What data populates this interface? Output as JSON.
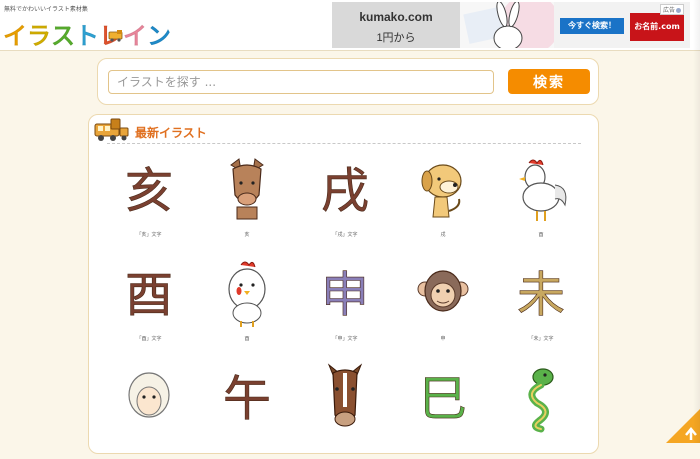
{
  "header": {
    "tagline": "無料でかわいいイラスト素材集",
    "logo_chars": [
      "イ",
      "ラ",
      "ス",
      "ト",
      "レ",
      "イ",
      "ン"
    ],
    "logo_colors": [
      "#f0a400",
      "#d9b400",
      "#5ab22e",
      "#2fa6d9",
      "#e6542e",
      "#f08aa0",
      "#1f8fd0"
    ],
    "ad": {
      "domain": "kumako.com",
      "price": "1円から",
      "cta": "今すぐ検索！",
      "brand": "お名前.com",
      "label": "広告"
    }
  },
  "search": {
    "placeholder": "イラストを探す ...",
    "value": "",
    "button_label": "検索"
  },
  "section": {
    "title": "最新イラスト"
  },
  "illustrations": [
    {
      "kind": "kanji",
      "glyph": "亥",
      "caption": "「亥」文字"
    },
    {
      "kind": "boar",
      "caption": "亥"
    },
    {
      "kind": "kanji",
      "glyph": "戌",
      "caption": "「戌」文字"
    },
    {
      "kind": "dog",
      "caption": "戌"
    },
    {
      "kind": "rooster",
      "caption": "酉"
    },
    {
      "kind": "kanji",
      "glyph": "酉",
      "caption": "「酉」文字"
    },
    {
      "kind": "chick",
      "caption": "酉"
    },
    {
      "kind": "kanji",
      "glyph": "申",
      "caption": "「申」文字"
    },
    {
      "kind": "monkey",
      "caption": "申"
    },
    {
      "kind": "kanji",
      "glyph": "未",
      "caption": "「未」文字"
    },
    {
      "kind": "sheep",
      "caption": ""
    },
    {
      "kind": "kanji",
      "glyph": "午",
      "caption": ""
    },
    {
      "kind": "horse",
      "caption": ""
    },
    {
      "kind": "kanji",
      "glyph": "巳",
      "caption": ""
    },
    {
      "kind": "snake",
      "caption": ""
    }
  ],
  "colors": {
    "accent": "#f58c00",
    "title": "#e07020",
    "background": "#fbf6e9"
  }
}
